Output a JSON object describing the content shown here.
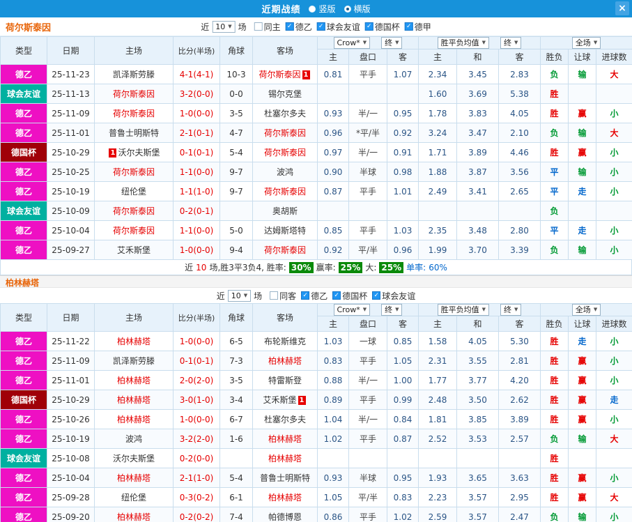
{
  "titlebar": {
    "title": "近期战绩",
    "vertical_label": "竖版",
    "horizontal_label": "横版",
    "close_glyph": "×"
  },
  "dropdowns": {
    "bookmaker": "Crow*",
    "final": "终",
    "avg": "胜平负均值",
    "final2": "终",
    "scope": "全场"
  },
  "table_headers": {
    "type": "类型",
    "date": "日期",
    "home": "主场",
    "score": "比分(半场)",
    "corner": "角球",
    "away": "客场",
    "odds_home": "主",
    "handicap": "盘口",
    "odds_away": "客",
    "avg_home": "主",
    "avg_draw": "和",
    "avg_away": "客",
    "result": "胜负",
    "handicap_result": "让球",
    "goals": "进球数"
  },
  "sections": [
    {
      "team": "荷尔斯泰因",
      "filter": {
        "near": "近",
        "count": "10",
        "unit": "场",
        "checkboxes": [
          {
            "label": "同主",
            "checked": false
          },
          {
            "label": "德乙",
            "checked": true
          },
          {
            "label": "球会友谊",
            "checked": true
          },
          {
            "label": "德国杯",
            "checked": true
          },
          {
            "label": "德甲",
            "checked": true
          }
        ]
      },
      "rows": [
        {
          "type": "德乙",
          "date": "25-11-23",
          "home": {
            "name": "凯泽斯劳滕"
          },
          "score": "4-1(4-1)",
          "corner": "10-3",
          "away": {
            "name": "荷尔斯泰因",
            "self": true,
            "badge": "1",
            "badge_pos": "after"
          },
          "o1": "0.81",
          "line": "平手",
          "o2": "1.07",
          "a1": "2.34",
          "ax": "3.45",
          "a2": "2.83",
          "res": "负",
          "hres": "输",
          "gres": "大"
        },
        {
          "type": "球会友谊",
          "date": "25-11-13",
          "home": {
            "name": "荷尔斯泰因",
            "self": true
          },
          "score": "3-2(0-0)",
          "corner": "0-0",
          "away": {
            "name": "锡尔克堡"
          },
          "o1": "",
          "line": "",
          "o2": "",
          "a1": "1.60",
          "ax": "3.69",
          "a2": "5.38",
          "res": "胜",
          "hres": "",
          "gres": ""
        },
        {
          "type": "德乙",
          "date": "25-11-09",
          "home": {
            "name": "荷尔斯泰因",
            "self": true
          },
          "score": "1-0(0-0)",
          "corner": "3-5",
          "away": {
            "name": "杜塞尔多夫"
          },
          "o1": "0.93",
          "line": "半/一",
          "o2": "0.95",
          "a1": "1.78",
          "ax": "3.83",
          "a2": "4.05",
          "res": "胜",
          "hres": "赢",
          "gres": "小"
        },
        {
          "type": "德乙",
          "date": "25-11-01",
          "home": {
            "name": "普鲁士明斯特"
          },
          "score": "2-1(0-1)",
          "corner": "4-7",
          "away": {
            "name": "荷尔斯泰因",
            "self": true
          },
          "o1": "0.96",
          "line": "*平/半",
          "o2": "0.92",
          "a1": "3.24",
          "ax": "3.47",
          "a2": "2.10",
          "res": "负",
          "hres": "输",
          "gres": "大"
        },
        {
          "type": "德国杯",
          "date": "25-10-29",
          "home": {
            "name": "沃尔夫斯堡",
            "badge": "1",
            "badge_pos": "before"
          },
          "score": "0-1(0-1)",
          "corner": "5-4",
          "away": {
            "name": "荷尔斯泰因",
            "self": true
          },
          "o1": "0.97",
          "line": "半/一",
          "o2": "0.91",
          "a1": "1.71",
          "ax": "3.89",
          "a2": "4.46",
          "res": "胜",
          "hres": "赢",
          "gres": "小"
        },
        {
          "type": "德乙",
          "date": "25-10-25",
          "home": {
            "name": "荷尔斯泰因",
            "self": true
          },
          "score": "1-1(0-0)",
          "corner": "9-7",
          "away": {
            "name": "波鸿"
          },
          "o1": "0.90",
          "line": "半球",
          "o2": "0.98",
          "a1": "1.88",
          "ax": "3.87",
          "a2": "3.56",
          "res": "平",
          "hres": "输",
          "gres": "小"
        },
        {
          "type": "德乙",
          "date": "25-10-19",
          "home": {
            "name": "纽伦堡"
          },
          "score": "1-1(1-0)",
          "corner": "9-7",
          "away": {
            "name": "荷尔斯泰因",
            "self": true
          },
          "o1": "0.87",
          "line": "平手",
          "o2": "1.01",
          "a1": "2.49",
          "ax": "3.41",
          "a2": "2.65",
          "res": "平",
          "hres": "走",
          "gres": "小"
        },
        {
          "type": "球会友谊",
          "date": "25-10-09",
          "home": {
            "name": "荷尔斯泰因",
            "self": true
          },
          "score": "0-2(0-1)",
          "corner": "",
          "away": {
            "name": "奥胡斯"
          },
          "o1": "",
          "line": "",
          "o2": "",
          "a1": "",
          "ax": "",
          "a2": "",
          "res": "负",
          "hres": "",
          "gres": ""
        },
        {
          "type": "德乙",
          "date": "25-10-04",
          "home": {
            "name": "荷尔斯泰因",
            "self": true
          },
          "score": "1-1(0-0)",
          "corner": "5-0",
          "away": {
            "name": "达姆斯塔特"
          },
          "o1": "0.85",
          "line": "平手",
          "o2": "1.03",
          "a1": "2.35",
          "ax": "3.48",
          "a2": "2.80",
          "res": "平",
          "hres": "走",
          "gres": "小"
        },
        {
          "type": "德乙",
          "date": "25-09-27",
          "home": {
            "name": "艾禾斯堡"
          },
          "score": "1-0(0-0)",
          "corner": "9-4",
          "away": {
            "name": "荷尔斯泰因",
            "self": true
          },
          "o1": "0.92",
          "line": "平/半",
          "o2": "0.96",
          "a1": "1.99",
          "ax": "3.70",
          "a2": "3.39",
          "res": "负",
          "hres": "输",
          "gres": "小"
        }
      ],
      "summary": {
        "prefix": "近",
        "count": "10",
        "mid": "场,胜3平3负4, 胜率:",
        "win_pct": "30%",
        "label_asian": "赢率:",
        "asian_pct": "25%",
        "label_big": "大:",
        "big_pct": "25%",
        "label_single": "单率:",
        "single_pct": "60%"
      }
    },
    {
      "team": "柏林赫塔",
      "filter": {
        "near": "近",
        "count": "10",
        "unit": "场",
        "checkboxes": [
          {
            "label": "同客",
            "checked": false
          },
          {
            "label": "德乙",
            "checked": true
          },
          {
            "label": "德国杯",
            "checked": true
          },
          {
            "label": "球会友谊",
            "checked": true
          }
        ]
      },
      "rows": [
        {
          "type": "德乙",
          "date": "25-11-22",
          "home": {
            "name": "柏林赫塔",
            "self": true
          },
          "score": "1-0(0-0)",
          "corner": "6-5",
          "away": {
            "name": "布轮斯维克"
          },
          "o1": "1.03",
          "line": "一球",
          "o2": "0.85",
          "a1": "1.58",
          "ax": "4.05",
          "a2": "5.30",
          "res": "胜",
          "hres": "走",
          "gres": "小"
        },
        {
          "type": "德乙",
          "date": "25-11-09",
          "home": {
            "name": "凯泽斯劳滕"
          },
          "score": "0-1(0-1)",
          "corner": "7-3",
          "away": {
            "name": "柏林赫塔",
            "self": true
          },
          "o1": "0.83",
          "line": "平手",
          "o2": "1.05",
          "a1": "2.31",
          "ax": "3.55",
          "a2": "2.81",
          "res": "胜",
          "hres": "赢",
          "gres": "小"
        },
        {
          "type": "德乙",
          "date": "25-11-01",
          "home": {
            "name": "柏林赫塔",
            "self": true
          },
          "score": "2-0(2-0)",
          "corner": "3-5",
          "away": {
            "name": "特雷斯登"
          },
          "o1": "0.88",
          "line": "半/一",
          "o2": "1.00",
          "a1": "1.77",
          "ax": "3.77",
          "a2": "4.20",
          "res": "胜",
          "hres": "赢",
          "gres": "小"
        },
        {
          "type": "德国杯",
          "date": "25-10-29",
          "home": {
            "name": "柏林赫塔",
            "self": true
          },
          "score": "3-0(1-0)",
          "corner": "3-4",
          "away": {
            "name": "艾禾斯堡",
            "badge": "1",
            "badge_pos": "after"
          },
          "o1": "0.89",
          "line": "平手",
          "o2": "0.99",
          "a1": "2.48",
          "ax": "3.50",
          "a2": "2.62",
          "res": "胜",
          "hres": "赢",
          "gres": "走"
        },
        {
          "type": "德乙",
          "date": "25-10-26",
          "home": {
            "name": "柏林赫塔",
            "self": true
          },
          "score": "1-0(0-0)",
          "corner": "6-7",
          "away": {
            "name": "杜塞尔多夫"
          },
          "o1": "1.04",
          "line": "半/一",
          "o2": "0.84",
          "a1": "1.81",
          "ax": "3.85",
          "a2": "3.89",
          "res": "胜",
          "hres": "赢",
          "gres": "小"
        },
        {
          "type": "德乙",
          "date": "25-10-19",
          "home": {
            "name": "波鸿"
          },
          "score": "3-2(2-0)",
          "corner": "1-6",
          "away": {
            "name": "柏林赫塔",
            "self": true
          },
          "o1": "1.02",
          "line": "平手",
          "o2": "0.87",
          "a1": "2.52",
          "ax": "3.53",
          "a2": "2.57",
          "res": "负",
          "hres": "输",
          "gres": "大"
        },
        {
          "type": "球会友谊",
          "date": "25-10-08",
          "home": {
            "name": "沃尔夫斯堡"
          },
          "score": "0-2(0-0)",
          "corner": "",
          "away": {
            "name": "柏林赫塔",
            "self": true
          },
          "o1": "",
          "line": "",
          "o2": "",
          "a1": "",
          "ax": "",
          "a2": "",
          "res": "胜",
          "hres": "",
          "gres": ""
        },
        {
          "type": "德乙",
          "date": "25-10-04",
          "home": {
            "name": "柏林赫塔",
            "self": true
          },
          "score": "2-1(1-0)",
          "corner": "5-4",
          "away": {
            "name": "普鲁士明斯特"
          },
          "o1": "0.93",
          "line": "半球",
          "o2": "0.95",
          "a1": "1.93",
          "ax": "3.65",
          "a2": "3.63",
          "res": "胜",
          "hres": "赢",
          "gres": "小"
        },
        {
          "type": "德乙",
          "date": "25-09-28",
          "home": {
            "name": "纽伦堡"
          },
          "score": "0-3(0-2)",
          "corner": "6-1",
          "away": {
            "name": "柏林赫塔",
            "self": true
          },
          "o1": "1.05",
          "line": "平/半",
          "o2": "0.83",
          "a1": "2.23",
          "ax": "3.57",
          "a2": "2.95",
          "res": "胜",
          "hres": "赢",
          "gres": "大"
        },
        {
          "type": "德乙",
          "date": "25-09-20",
          "home": {
            "name": "柏林赫塔",
            "self": true
          },
          "score": "0-2(0-2)",
          "corner": "7-4",
          "away": {
            "name": "帕德博恩"
          },
          "o1": "0.86",
          "line": "平手",
          "o2": "1.02",
          "a1": "2.59",
          "ax": "3.57",
          "a2": "2.47",
          "res": "负",
          "hres": "输",
          "gres": "小"
        }
      ]
    }
  ]
}
